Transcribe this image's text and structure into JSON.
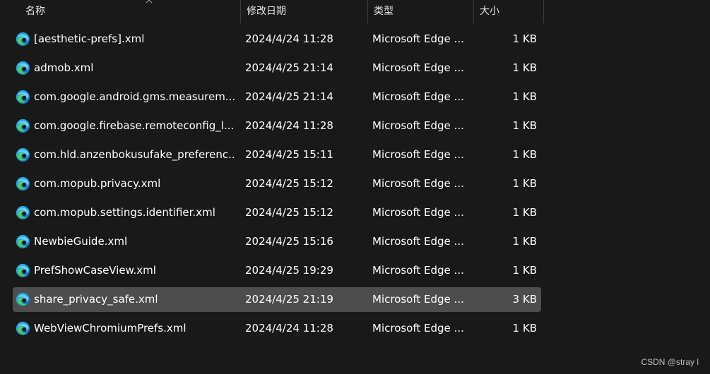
{
  "columns": {
    "name": "名称",
    "date": "修改日期",
    "type": "类型",
    "size": "大小"
  },
  "files": [
    {
      "name": "[aesthetic-prefs].xml",
      "date": "2024/4/24 11:28",
      "type": "Microsoft Edge ...",
      "size": "1 KB",
      "selected": false
    },
    {
      "name": "admob.xml",
      "date": "2024/4/25 21:14",
      "type": "Microsoft Edge ...",
      "size": "1 KB",
      "selected": false
    },
    {
      "name": "com.google.android.gms.measurem...",
      "date": "2024/4/25 21:14",
      "type": "Microsoft Edge ...",
      "size": "1 KB",
      "selected": false
    },
    {
      "name": "com.google.firebase.remoteconfig_l...",
      "date": "2024/4/24 11:28",
      "type": "Microsoft Edge ...",
      "size": "1 KB",
      "selected": false
    },
    {
      "name": "com.hld.anzenbokusufake_preferenc...",
      "date": "2024/4/25 15:11",
      "type": "Microsoft Edge ...",
      "size": "1 KB",
      "selected": false
    },
    {
      "name": "com.mopub.privacy.xml",
      "date": "2024/4/25 15:12",
      "type": "Microsoft Edge ...",
      "size": "1 KB",
      "selected": false
    },
    {
      "name": "com.mopub.settings.identifier.xml",
      "date": "2024/4/25 15:12",
      "type": "Microsoft Edge ...",
      "size": "1 KB",
      "selected": false
    },
    {
      "name": "NewbieGuide.xml",
      "date": "2024/4/25 15:16",
      "type": "Microsoft Edge ...",
      "size": "1 KB",
      "selected": false
    },
    {
      "name": "PrefShowCaseView.xml",
      "date": "2024/4/25 19:29",
      "type": "Microsoft Edge ...",
      "size": "1 KB",
      "selected": false
    },
    {
      "name": "share_privacy_safe.xml",
      "date": "2024/4/25 21:19",
      "type": "Microsoft Edge ...",
      "size": "3 KB",
      "selected": true
    },
    {
      "name": "WebViewChromiumPrefs.xml",
      "date": "2024/4/24 11:28",
      "type": "Microsoft Edge ...",
      "size": "1 KB",
      "selected": false
    }
  ],
  "file_icon": "edge-icon",
  "sort_indicator": "sort-ascending-icon",
  "watermark": "CSDN @stray l",
  "colors": {
    "background": "#191919",
    "selected_row": "#4d4d4d",
    "text": "#ffffff"
  }
}
